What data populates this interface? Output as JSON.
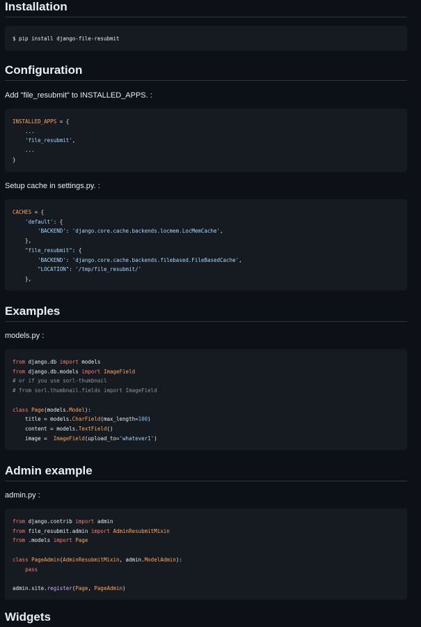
{
  "installation": {
    "heading": "Installation",
    "command": "$ pip install django-file-resubmit"
  },
  "configuration": {
    "heading": "Configuration",
    "intro": "Add \"file_resubmit\" to INSTALLED_APPS. :",
    "cache_intro": "Setup cache in settings.py. :"
  },
  "examples": {
    "heading": "Examples",
    "file_label": "models.py :"
  },
  "admin_example": {
    "heading": "Admin example",
    "file_label": "admin.py :"
  },
  "next_section": {
    "heading": "Widgets"
  },
  "code": {
    "installed_apps": [
      {
        "t": "var",
        "v": "INSTALLED_APPS"
      },
      {
        "t": "",
        "v": " = {\n    ...\n    "
      },
      {
        "t": "str",
        "v": "'file_resubmit'"
      },
      {
        "t": "",
        "v": ",\n    ...\n}"
      }
    ],
    "caches": [
      {
        "t": "var",
        "v": "CACHES"
      },
      {
        "t": "",
        "v": " = {\n    "
      },
      {
        "t": "str",
        "v": "'default'"
      },
      {
        "t": "",
        "v": ": {\n        "
      },
      {
        "t": "str",
        "v": "'BACKEND'"
      },
      {
        "t": "",
        "v": ": "
      },
      {
        "t": "str",
        "v": "'django.core.cache.backends.locmem.LocMemCache'"
      },
      {
        "t": "",
        "v": ",\n    },\n    "
      },
      {
        "t": "str",
        "v": "\"file_resubmit\""
      },
      {
        "t": "",
        "v": ": {\n        "
      },
      {
        "t": "str",
        "v": "'BACKEND'"
      },
      {
        "t": "",
        "v": ": "
      },
      {
        "t": "str",
        "v": "'django.core.cache.backends.filebased.FileBasedCache'"
      },
      {
        "t": "",
        "v": ",\n        "
      },
      {
        "t": "str",
        "v": "\"LOCATION\""
      },
      {
        "t": "",
        "v": ": "
      },
      {
        "t": "str",
        "v": "'/tmp/file_resubmit/'"
      },
      {
        "t": "",
        "v": "\n    },"
      }
    ],
    "models": [
      {
        "t": "kw",
        "v": "from"
      },
      {
        "t": "",
        "v": " django.db "
      },
      {
        "t": "kw",
        "v": "import"
      },
      {
        "t": "",
        "v": " models\n"
      },
      {
        "t": "kw",
        "v": "from"
      },
      {
        "t": "",
        "v": " django.db.models "
      },
      {
        "t": "kw",
        "v": "import"
      },
      {
        "t": "",
        "v": " "
      },
      {
        "t": "cls",
        "v": "ImageField"
      },
      {
        "t": "",
        "v": "\n"
      },
      {
        "t": "cm",
        "v": "# or if you use sorl-thumbnail\n# from sorl.thumbnail.fields import ImageField"
      },
      {
        "t": "",
        "v": "\n\n"
      },
      {
        "t": "kw",
        "v": "class"
      },
      {
        "t": "",
        "v": " "
      },
      {
        "t": "cls",
        "v": "Page"
      },
      {
        "t": "",
        "v": "(models."
      },
      {
        "t": "cls",
        "v": "Model"
      },
      {
        "t": "",
        "v": "):\n    title = models."
      },
      {
        "t": "cls",
        "v": "CharField"
      },
      {
        "t": "",
        "v": "(max_length="
      },
      {
        "t": "num",
        "v": "100"
      },
      {
        "t": "",
        "v": ")\n    content = models."
      },
      {
        "t": "cls",
        "v": "TextField"
      },
      {
        "t": "",
        "v": "()\n    image =  "
      },
      {
        "t": "cls",
        "v": "ImageField"
      },
      {
        "t": "",
        "v": "(upload_to="
      },
      {
        "t": "str",
        "v": "'whatever1'"
      },
      {
        "t": "",
        "v": ")"
      }
    ],
    "admin": [
      {
        "t": "kw",
        "v": "from"
      },
      {
        "t": "",
        "v": " django.contrib "
      },
      {
        "t": "kw",
        "v": "import"
      },
      {
        "t": "",
        "v": " admin\n"
      },
      {
        "t": "kw",
        "v": "from"
      },
      {
        "t": "",
        "v": " file_resubmit.admin "
      },
      {
        "t": "kw",
        "v": "import"
      },
      {
        "t": "",
        "v": " "
      },
      {
        "t": "cls",
        "v": "AdminResubmitMixin"
      },
      {
        "t": "",
        "v": "\n"
      },
      {
        "t": "kw",
        "v": "from"
      },
      {
        "t": "",
        "v": " .models "
      },
      {
        "t": "kw",
        "v": "import"
      },
      {
        "t": "",
        "v": " "
      },
      {
        "t": "cls",
        "v": "Page"
      },
      {
        "t": "",
        "v": "\n\n"
      },
      {
        "t": "kw",
        "v": "class"
      },
      {
        "t": "",
        "v": " "
      },
      {
        "t": "cls",
        "v": "PageAdmin"
      },
      {
        "t": "",
        "v": "("
      },
      {
        "t": "cls",
        "v": "AdminResubmitMixin"
      },
      {
        "t": "",
        "v": ", admin."
      },
      {
        "t": "cls",
        "v": "ModelAdmin"
      },
      {
        "t": "",
        "v": "):\n    "
      },
      {
        "t": "kw",
        "v": "pass"
      },
      {
        "t": "",
        "v": "\n\nadmin.site."
      },
      {
        "t": "fn",
        "v": "register"
      },
      {
        "t": "",
        "v": "("
      },
      {
        "t": "cls",
        "v": "Page"
      },
      {
        "t": "",
        "v": ", "
      },
      {
        "t": "cls",
        "v": "PageAdmin"
      },
      {
        "t": "",
        "v": ")"
      }
    ]
  }
}
